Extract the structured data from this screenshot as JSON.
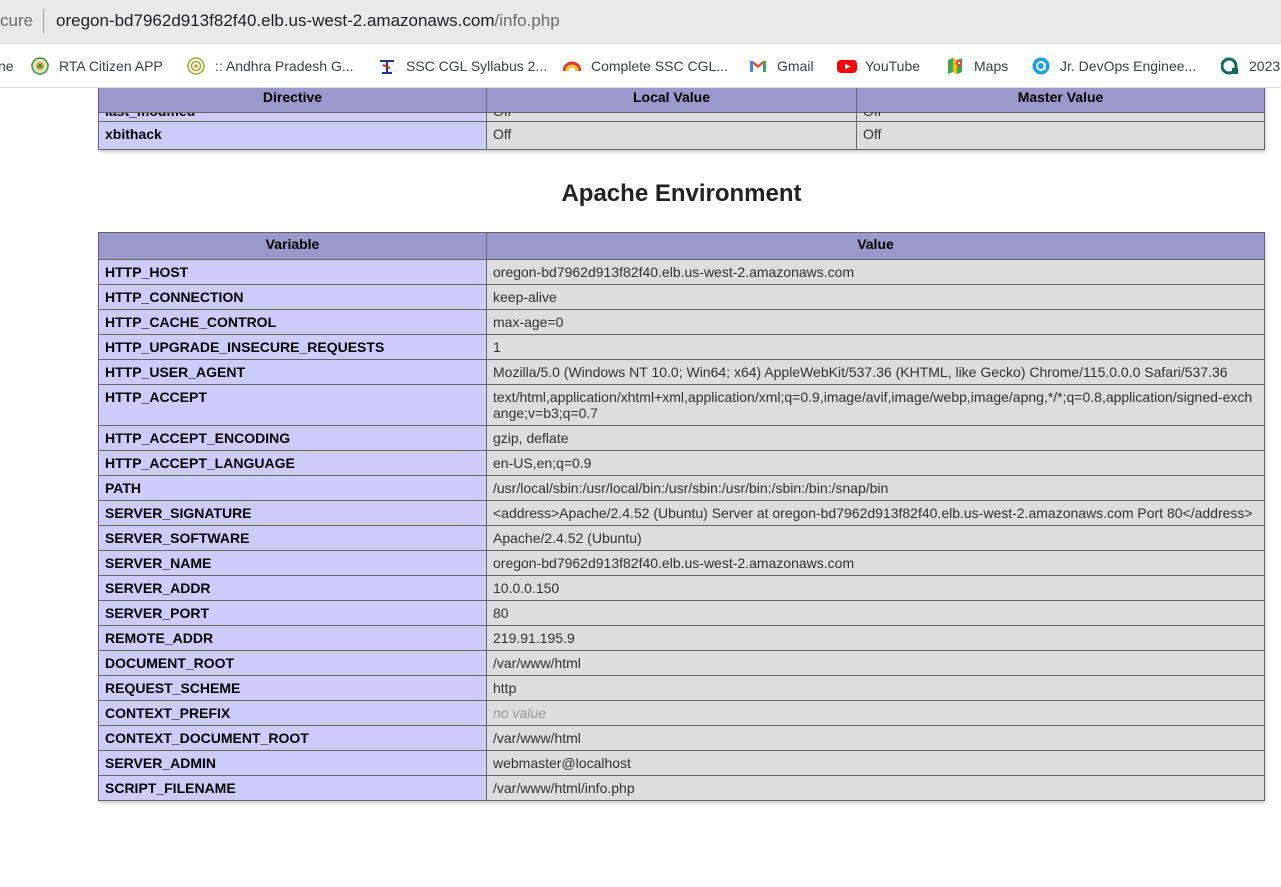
{
  "browser": {
    "security_label": "cure",
    "url_host": "oregon-bd7962d913f82f40.elb.us-west-2.amazonaws.com",
    "url_path": "/info.php",
    "bookmarks": [
      {
        "label": "ne",
        "icon": "none"
      },
      {
        "label": "RTA Citizen APP",
        "icon": "ap-govt-emblem-icon"
      },
      {
        "label": ":: Andhra Pradesh G...",
        "icon": "ap-seal-icon"
      },
      {
        "label": "SSC CGL Syllabus 2...",
        "icon": "ssc-runner-icon"
      },
      {
        "label": "Complete SSC CGL...",
        "icon": "rainbow-arc-icon"
      },
      {
        "label": "Gmail",
        "icon": "gmail-icon"
      },
      {
        "label": "YouTube",
        "icon": "youtube-icon"
      },
      {
        "label": "Maps",
        "icon": "maps-icon"
      },
      {
        "label": "Jr. DevOps Enginee...",
        "icon": "circle-a-icon"
      },
      {
        "label": "2023",
        "icon": "teal-logo-icon"
      }
    ]
  },
  "top_table": {
    "headers": [
      "Directive",
      "Local Value",
      "Master Value"
    ],
    "rows": [
      {
        "directive": "last_modified",
        "local": "Off",
        "master": "Off"
      },
      {
        "directive": "xbithack",
        "local": "Off",
        "master": "Off"
      }
    ]
  },
  "section": {
    "title": "Apache Environment"
  },
  "env_table": {
    "headers": [
      "Variable",
      "Value"
    ],
    "rows": [
      {
        "name": "HTTP_HOST",
        "value": "oregon-bd7962d913f82f40.elb.us-west-2.amazonaws.com"
      },
      {
        "name": "HTTP_CONNECTION",
        "value": "keep-alive"
      },
      {
        "name": "HTTP_CACHE_CONTROL",
        "value": "max-age=0"
      },
      {
        "name": "HTTP_UPGRADE_INSECURE_REQUESTS",
        "value": "1"
      },
      {
        "name": "HTTP_USER_AGENT",
        "value": "Mozilla/5.0 (Windows NT 10.0; Win64; x64) AppleWebKit/537.36 (KHTML, like Gecko) Chrome/115.0.0.0 Safari/537.36"
      },
      {
        "name": "HTTP_ACCEPT",
        "value": "text/html,application/xhtml+xml,application/xml;q=0.9,image/avif,image/webp,image/apng,*/*;q=0.8,application/signed-exchange;v=b3;q=0.7"
      },
      {
        "name": "HTTP_ACCEPT_ENCODING",
        "value": "gzip, deflate"
      },
      {
        "name": "HTTP_ACCEPT_LANGUAGE",
        "value": "en-US,en;q=0.9"
      },
      {
        "name": "PATH",
        "value": "/usr/local/sbin:/usr/local/bin:/usr/sbin:/usr/bin:/sbin:/bin:/snap/bin"
      },
      {
        "name": "SERVER_SIGNATURE",
        "value": "<address>Apache/2.4.52 (Ubuntu) Server at oregon-bd7962d913f82f40.elb.us-west-2.amazonaws.com Port 80</address>"
      },
      {
        "name": "SERVER_SOFTWARE",
        "value": "Apache/2.4.52 (Ubuntu)"
      },
      {
        "name": "SERVER_NAME",
        "value": "oregon-bd7962d913f82f40.elb.us-west-2.amazonaws.com"
      },
      {
        "name": "SERVER_ADDR",
        "value": "10.0.0.150"
      },
      {
        "name": "SERVER_PORT",
        "value": "80"
      },
      {
        "name": "REMOTE_ADDR",
        "value": "219.91.195.9"
      },
      {
        "name": "DOCUMENT_ROOT",
        "value": "/var/www/html"
      },
      {
        "name": "REQUEST_SCHEME",
        "value": "http"
      },
      {
        "name": "CONTEXT_PREFIX",
        "value": "no value",
        "novalue": true
      },
      {
        "name": "CONTEXT_DOCUMENT_ROOT",
        "value": "/var/www/html"
      },
      {
        "name": "SERVER_ADMIN",
        "value": "webmaster@localhost"
      },
      {
        "name": "SCRIPT_FILENAME",
        "value": "/var/www/html/info.php"
      }
    ]
  }
}
